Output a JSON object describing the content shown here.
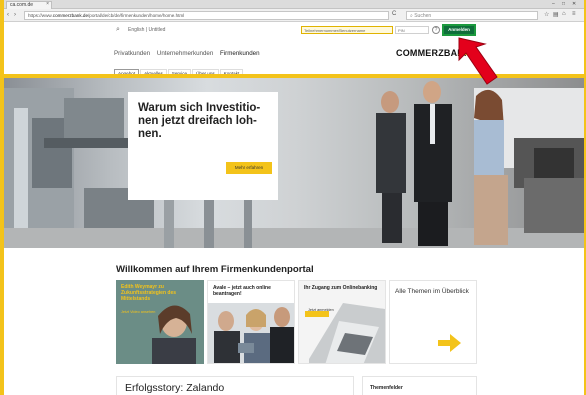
{
  "browser": {
    "tab_title": "ca.com.de",
    "tab_close": "×",
    "window_controls": {
      "minimize": "–",
      "maximize": "□",
      "close": "✕"
    },
    "url_prefix": "https://www.",
    "url_domain": "commerzbank.de",
    "url_path": "/portal/de/cb/de/firmenkunden/home/home.html",
    "reload_glyph": "C",
    "search_placeholder": "Suchen",
    "toolbar_icons": [
      "star-icon",
      "bookmark-icon",
      "home-icon",
      "menu-icon"
    ]
  },
  "header": {
    "search_lang": "English | Untitled",
    "login_field_placeholder": "Teilnehmernummer/Benutzername",
    "pin_field_placeholder": "PIN",
    "help_glyph": "?",
    "login_button": "Anmelden",
    "segments": [
      {
        "label": "Privatkunden",
        "active": false
      },
      {
        "label": "Unternehmerkunden",
        "active": false
      },
      {
        "label": "Firmenkunden",
        "active": true
      }
    ],
    "logo_text": "COMMERZBANK",
    "subnav": [
      {
        "label": "Angebot",
        "active": true
      },
      {
        "label": "Aktuelles",
        "active": false
      },
      {
        "label": "Service",
        "active": false
      },
      {
        "label": "Über uns",
        "active": false
      },
      {
        "label": "Kontakt",
        "active": false
      }
    ]
  },
  "hero": {
    "title": "Warum sich Investitio-nen jetzt dreifach loh-nen.",
    "button": "Mehr erfahren"
  },
  "welcome": {
    "heading": "Willkommen auf Ihrem Firmenkundenportal",
    "tiles": [
      {
        "text": "Edith Weymayr zu Zukunftsstrategien des Mittelstands",
        "sub": "Jetzt Video ansehen"
      },
      {
        "text": "Avale – jetzt auch online beantragen!"
      },
      {
        "text": "Ihr Zugang zum Onlinebanking",
        "sub": "Jetzt anmelden"
      },
      {
        "text": "Alle Themen im Überblick"
      }
    ]
  },
  "story": {
    "title": "Erfolgsstory: Zalando"
  },
  "topics": {
    "title": "Themenfelder"
  },
  "colors": {
    "brand_yellow": "#f3c31a",
    "login_green": "#0f6e3b",
    "annotation_red": "#e3001b"
  }
}
